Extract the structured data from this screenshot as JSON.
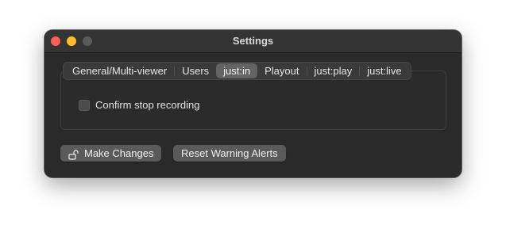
{
  "window": {
    "title": "Settings"
  },
  "tabs": [
    {
      "label": "General/Multi-viewer",
      "active": false
    },
    {
      "label": "Users",
      "active": false
    },
    {
      "label": "just:in",
      "active": true
    },
    {
      "label": "Playout",
      "active": false
    },
    {
      "label": "just:play",
      "active": false
    },
    {
      "label": "just:live",
      "active": false
    }
  ],
  "content": {
    "confirm_stop_recording": {
      "label": "Confirm stop recording",
      "checked": false
    }
  },
  "footer": {
    "make_changes_label": "Make Changes",
    "lock_icon": "unlocked-padlock-icon",
    "reset_warning_alerts_label": "Reset Warning Alerts"
  },
  "colors": {
    "close": "#ff5f57",
    "minimize": "#febc2e",
    "zoom_inactive": "#5a5a5a",
    "window_bg": "#2a2a2a",
    "active_tab": "#636363"
  }
}
